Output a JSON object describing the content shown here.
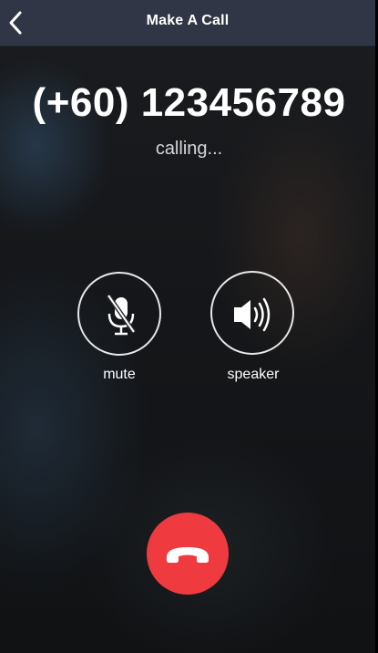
{
  "header": {
    "title": "Make A Call",
    "back_icon": "chevron-left-icon"
  },
  "call": {
    "number": "(+60) 123456789",
    "status": "calling..."
  },
  "controls": {
    "mute": {
      "label": "mute",
      "icon": "mic-off-icon"
    },
    "speaker": {
      "label": "speaker",
      "icon": "speaker-icon"
    }
  },
  "end_call": {
    "icon": "phone-hangup-icon",
    "color": "#ef3b3f"
  },
  "colors": {
    "topbar": "#303645",
    "accent_end_call": "#ef3b3f",
    "text": "#ffffff"
  }
}
